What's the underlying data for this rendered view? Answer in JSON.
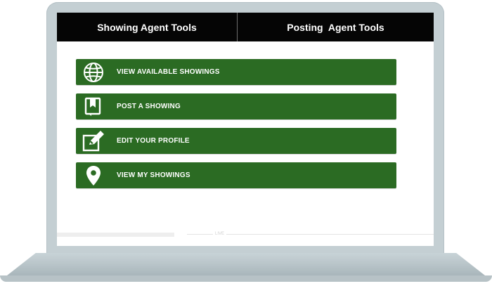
{
  "header": {
    "left_tab": "Showing Agent Tools",
    "right_tab": "Posting  Agent Tools"
  },
  "menu": {
    "items": [
      {
        "label": "VIEW AVAILABLE SHOWINGS",
        "icon": "globe-icon"
      },
      {
        "label": "POST A SHOWING",
        "icon": "document-bookmark-icon"
      },
      {
        "label": "EDIT YOUR PROFILE",
        "icon": "edit-pencil-icon"
      },
      {
        "label": "VIEW MY SHOWINGS",
        "icon": "map-pin-icon"
      }
    ]
  },
  "footer": {
    "text": "LIVE"
  },
  "colors": {
    "header_bg": "#050505",
    "button_green": "#2b6b23",
    "laptop_frame": "#c4cfd3"
  }
}
